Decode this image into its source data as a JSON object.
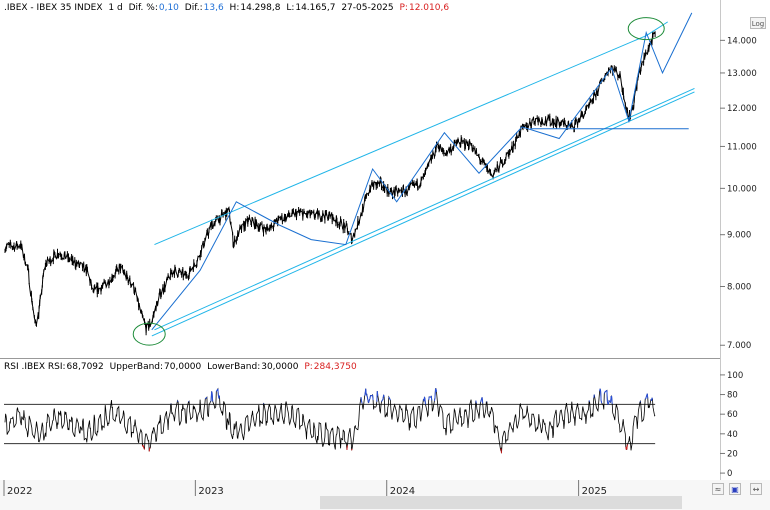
{
  "price_header": {
    "symbol": ".IBEX - IBEX 35 INDEX",
    "interval": "1 d",
    "dif_pct_label": "Dif. %:",
    "dif_pct_value": "0,10",
    "dif_label": "Dif.:",
    "dif_value": "13,6",
    "h_label": "H:",
    "h_value": "14.298,8",
    "l_label": "L:",
    "l_value": "14.165,7",
    "date": "27-05-2025",
    "p_label": "P:",
    "p_value": "12.010,6"
  },
  "rsi_header": {
    "study": "RSI .IBEX RSI:",
    "rsi_value": "68,7092",
    "upper_label": "UpperBand:",
    "upper_value": "70,0000",
    "lower_label": "LowerBand:",
    "lower_value": "30,0000",
    "p_label": "P:",
    "p_value": "284,3750"
  },
  "controls": {
    "log_label": "Log",
    "wave_icon": "wave-icon",
    "save_icon": "disk-icon",
    "expand_icon": "arrows-icon"
  },
  "colors": {
    "price_line": "#000000",
    "channel_line": "#20b5e8",
    "wave_line": "#1a6fd0",
    "ellipse": "#1e8c3a",
    "rsi_line": "#000000",
    "rsi_overbought": "#2a4fd8",
    "rsi_oversold": "#d21e1e",
    "band_line": "#333333",
    "grid_sep": "#999999"
  },
  "chart_data": [
    {
      "type": "line",
      "title": ".IBEX - IBEX 35 INDEX",
      "scale": "log",
      "ylim": [
        6800,
        15000
      ],
      "y_ticks": [
        7000,
        8000,
        9000,
        10000,
        11000,
        12000,
        13000,
        14000
      ],
      "y_tick_labels": [
        "7.000",
        "8.000",
        "9.000",
        "10.000",
        "11.000",
        "12.000",
        "13.000",
        "14.000"
      ],
      "x_tick_labels": [
        "2022",
        "2023",
        "2024",
        "2025"
      ],
      "series": [
        {
          "x": [
            "2022-01-03",
            "2022-02-01",
            "2022-02-15",
            "2022-03-01",
            "2022-03-08",
            "2022-03-20",
            "2022-04-15",
            "2022-05-15",
            "2022-06-08",
            "2022-06-20",
            "2022-07-10",
            "2022-08-10",
            "2022-09-05",
            "2022-09-20",
            "2022-09-30",
            "2022-10-10",
            "2022-10-25",
            "2022-11-20",
            "2022-12-15",
            "2023-01-05",
            "2023-02-01",
            "2023-03-06",
            "2023-03-15",
            "2023-03-25",
            "2023-04-15",
            "2023-05-15",
            "2023-06-15",
            "2023-07-15",
            "2023-08-15",
            "2023-09-15",
            "2023-10-15",
            "2023-10-27",
            "2023-11-15",
            "2023-12-01",
            "2023-12-20",
            "2024-01-10",
            "2024-02-10",
            "2024-03-10",
            "2024-04-08",
            "2024-04-20",
            "2024-05-15",
            "2024-06-10",
            "2024-06-20",
            "2024-07-20",
            "2024-08-05",
            "2024-08-25",
            "2024-09-10",
            "2024-10-10",
            "2024-11-15",
            "2024-12-20",
            "2025-01-20",
            "2025-02-20",
            "2025-03-03",
            "2025-03-20",
            "2025-04-07",
            "2025-04-15",
            "2025-04-25",
            "2025-05-10",
            "2025-05-27"
          ],
          "values": [
            8750,
            8800,
            8350,
            7350,
            7500,
            8400,
            8650,
            8450,
            8300,
            7900,
            8000,
            8350,
            8000,
            7500,
            7250,
            7400,
            7850,
            8300,
            8200,
            8500,
            9200,
            9500,
            8800,
            9050,
            9300,
            9100,
            9350,
            9450,
            9400,
            9400,
            9150,
            8900,
            9500,
            10050,
            10100,
            9900,
            9950,
            10200,
            11050,
            10800,
            11100,
            11050,
            10800,
            10300,
            10550,
            10900,
            11350,
            11700,
            11650,
            11500,
            12000,
            12900,
            13200,
            12950,
            11700,
            12050,
            12900,
            13600,
            14200
          ]
        }
      ]
    },
    {
      "type": "line",
      "title": "RSI .IBEX RSI",
      "ylim": [
        -5,
        105
      ],
      "y_ticks": [
        0,
        20,
        40,
        60,
        80,
        100
      ],
      "upper_band": 70,
      "lower_band": 30,
      "series": [
        {
          "x": [
            "2022-01-03",
            "2022-02-01",
            "2022-03-07",
            "2022-04-15",
            "2022-06-10",
            "2022-07-25",
            "2022-09-05",
            "2022-09-30",
            "2022-11-20",
            "2023-01-10",
            "2023-02-10",
            "2023-03-15",
            "2023-05-01",
            "2023-07-01",
            "2023-08-15",
            "2023-10-27",
            "2023-11-20",
            "2023-12-20",
            "2024-02-15",
            "2024-04-05",
            "2024-04-20",
            "2024-06-15",
            "2024-07-15",
            "2024-08-05",
            "2024-09-15",
            "2024-11-01",
            "2024-12-01",
            "2025-01-20",
            "2025-02-25",
            "2025-04-07",
            "2025-04-20",
            "2025-05-15",
            "2025-05-27"
          ],
          "values": [
            48,
            56,
            38,
            58,
            40,
            62,
            45,
            31,
            62,
            62,
            78,
            40,
            58,
            60,
            42,
            33,
            79,
            72,
            55,
            76,
            50,
            62,
            68,
            30,
            64,
            44,
            58,
            62,
            80,
            28,
            55,
            73,
            68
          ]
        }
      ]
    }
  ]
}
